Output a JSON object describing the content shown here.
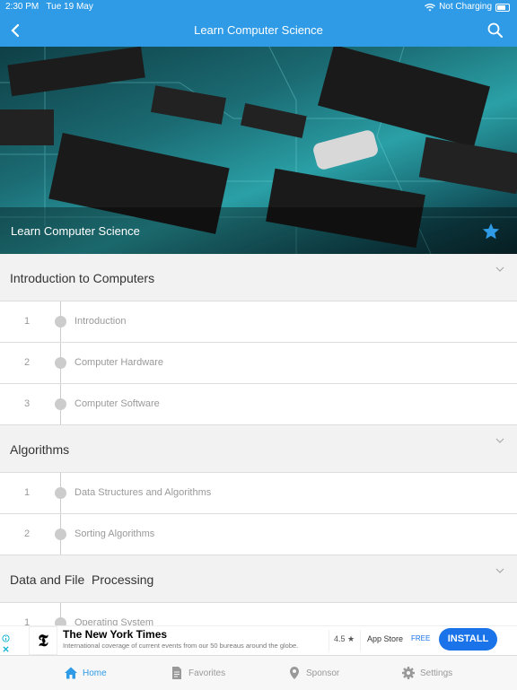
{
  "status_bar": {
    "time": "2:30 PM",
    "date": "Tue 19 May",
    "charging": "Not Charging"
  },
  "nav": {
    "title": "Learn Computer Science",
    "back_icon": "chevron-left-icon",
    "search_icon": "search-icon"
  },
  "hero": {
    "title": "Learn Computer Science",
    "favorite_icon": "star-icon"
  },
  "sections": [
    {
      "title": "Introduction to Computers",
      "lessons": [
        {
          "num": "1",
          "title": "Introduction"
        },
        {
          "num": "2",
          "title": "Computer Hardware"
        },
        {
          "num": "3",
          "title": "Computer Software"
        }
      ]
    },
    {
      "title": "Algorithms",
      "lessons": [
        {
          "num": "1",
          "title": "Data Structures and Algorithms"
        },
        {
          "num": "2",
          "title": "Sorting Algorithms"
        }
      ]
    },
    {
      "title": "Data and File  Processing",
      "lessons": [
        {
          "num": "1",
          "title": "Operating System"
        }
      ]
    }
  ],
  "ad": {
    "logo": "𝕿",
    "title": "The New York Times",
    "description": "International coverage of current events from our 50 bureaus around the globe.",
    "rating": "4.5 ★",
    "store": "App Store",
    "price": "FREE",
    "install_label": "INSTALL"
  },
  "tabs": [
    {
      "label": "Home",
      "icon": "home-icon"
    },
    {
      "label": "Favorites",
      "icon": "document-icon"
    },
    {
      "label": "Sponsor",
      "icon": "location-pin-icon"
    },
    {
      "label": "Settings",
      "icon": "gear-icon"
    }
  ],
  "colors": {
    "primary": "#2f9be6",
    "ad_button": "#1a73e8"
  }
}
